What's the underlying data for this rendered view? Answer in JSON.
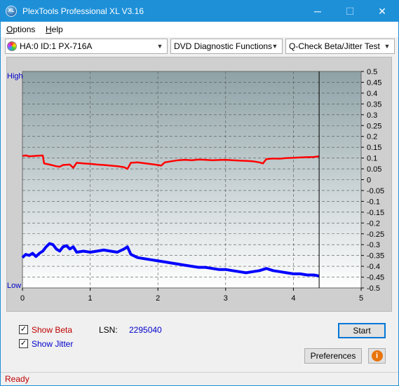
{
  "window": {
    "title": "PlexTools Professional XL V3.16",
    "icon_text": "XL",
    "minimize_glyph": "─",
    "maximize_glyph": "☐",
    "close_glyph": "✕"
  },
  "menu": [
    {
      "label": "Options",
      "accel": "O",
      "rest": "ptions"
    },
    {
      "label": "Help",
      "accel": "H",
      "rest": "elp"
    }
  ],
  "toolbar": {
    "drive": "HA:0 ID:1  PX-716A",
    "function": "DVD Diagnostic Functions",
    "test": "Q-Check Beta/Jitter Test",
    "arrow_glyph": "▼"
  },
  "chart_data": {
    "type": "line",
    "xlim": [
      0,
      5
    ],
    "x_ticks": [
      "0",
      "1",
      "2",
      "3",
      "4",
      "5"
    ],
    "ylim": [
      -0.5,
      0.5
    ],
    "y_ticks": [
      "0.5",
      "0.45",
      "0.4",
      "0.35",
      "0.3",
      "0.25",
      "0.2",
      "0.15",
      "0.1",
      "0.05",
      "0",
      "-0.05",
      "-0.1",
      "-0.15",
      "-0.2",
      "-0.25",
      "-0.3",
      "-0.35",
      "-0.4",
      "-0.45",
      "-0.5"
    ],
    "left_labels": {
      "top": "High",
      "bottom": "Low"
    },
    "end_marker_x": 4.38,
    "grid": true,
    "series": [
      {
        "color": "#ff0000",
        "x": [
          0,
          0.05,
          0.1,
          0.2,
          0.3,
          0.32,
          0.4,
          0.5,
          0.55,
          0.6,
          0.7,
          0.75,
          0.8,
          0.9,
          1.0,
          1.1,
          1.2,
          1.3,
          1.4,
          1.5,
          1.55,
          1.6,
          1.7,
          1.8,
          1.9,
          2.0,
          2.05,
          2.1,
          2.2,
          2.3,
          2.4,
          2.5,
          2.6,
          2.7,
          2.8,
          2.9,
          3.0,
          3.1,
          3.2,
          3.3,
          3.4,
          3.5,
          3.55,
          3.6,
          3.7,
          3.8,
          3.9,
          4.0,
          4.1,
          4.2,
          4.3,
          4.38
        ],
        "y": [
          0.11,
          0.112,
          0.108,
          0.11,
          0.112,
          0.075,
          0.07,
          0.062,
          0.06,
          0.068,
          0.07,
          0.055,
          0.078,
          0.075,
          0.073,
          0.07,
          0.068,
          0.065,
          0.062,
          0.058,
          0.05,
          0.078,
          0.08,
          0.076,
          0.072,
          0.068,
          0.065,
          0.08,
          0.085,
          0.09,
          0.092,
          0.09,
          0.093,
          0.092,
          0.09,
          0.091,
          0.092,
          0.09,
          0.088,
          0.087,
          0.085,
          0.08,
          0.075,
          0.095,
          0.098,
          0.097,
          0.1,
          0.101,
          0.103,
          0.104,
          0.105,
          0.108
        ]
      },
      {
        "color": "#0000ff",
        "x": [
          0,
          0.05,
          0.1,
          0.15,
          0.2,
          0.25,
          0.3,
          0.35,
          0.4,
          0.45,
          0.5,
          0.55,
          0.6,
          0.65,
          0.7,
          0.75,
          0.8,
          0.9,
          1.0,
          1.1,
          1.2,
          1.3,
          1.4,
          1.5,
          1.55,
          1.6,
          1.7,
          1.8,
          1.9,
          2.0,
          2.1,
          2.2,
          2.3,
          2.4,
          2.5,
          2.6,
          2.7,
          2.8,
          2.9,
          3.0,
          3.1,
          3.2,
          3.3,
          3.4,
          3.5,
          3.6,
          3.7,
          3.8,
          3.9,
          4.0,
          4.1,
          4.2,
          4.3,
          4.38
        ],
        "y": [
          -0.36,
          -0.345,
          -0.35,
          -0.34,
          -0.355,
          -0.34,
          -0.33,
          -0.31,
          -0.295,
          -0.3,
          -0.32,
          -0.33,
          -0.31,
          -0.305,
          -0.32,
          -0.31,
          -0.335,
          -0.33,
          -0.335,
          -0.33,
          -0.325,
          -0.33,
          -0.335,
          -0.32,
          -0.31,
          -0.345,
          -0.36,
          -0.365,
          -0.37,
          -0.375,
          -0.38,
          -0.385,
          -0.39,
          -0.395,
          -0.4,
          -0.405,
          -0.405,
          -0.41,
          -0.415,
          -0.415,
          -0.42,
          -0.425,
          -0.43,
          -0.425,
          -0.42,
          -0.41,
          -0.42,
          -0.425,
          -0.43,
          -0.435,
          -0.435,
          -0.44,
          -0.44,
          -0.445
        ]
      }
    ]
  },
  "options": {
    "show_beta_label": "Show Beta",
    "show_beta_checked": true,
    "show_jitter_label": "Show Jitter",
    "show_jitter_checked": true,
    "check_glyph": "✓",
    "lsn_label": "LSN:",
    "lsn_value": "2295040",
    "start_label": "Start",
    "preferences_label": "Preferences",
    "info_glyph": "i"
  },
  "status": {
    "text": "Ready"
  }
}
